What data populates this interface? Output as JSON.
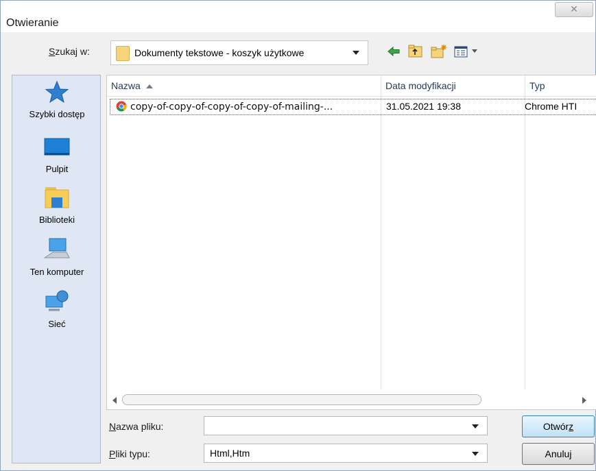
{
  "window": {
    "title": "Otwieranie",
    "close_glyph": "✕"
  },
  "look_in": {
    "label_prefix": "",
    "label_underline": "S",
    "label_rest": "zukaj w:",
    "value": "Dokumenty tekstowe - koszyk użytkowe"
  },
  "toolbar": {
    "icons": [
      "back-icon",
      "up-folder-icon",
      "new-folder-icon",
      "view-menu-icon"
    ]
  },
  "places": [
    {
      "label": "Szybki dostęp",
      "icon": "star-icon"
    },
    {
      "label": "Pulpit",
      "icon": "desktop-icon"
    },
    {
      "label": "Biblioteki",
      "icon": "libraries-icon"
    },
    {
      "label": "Ten komputer",
      "icon": "computer-icon"
    },
    {
      "label": "Sieć",
      "icon": "network-icon"
    }
  ],
  "file_list": {
    "columns": [
      "Nazwa",
      "Data modyfikacji",
      "Typ"
    ],
    "sort_column": "Nazwa",
    "rows": [
      {
        "name": "copy-of-copy-of-copy-of-copy-of-mailing-...",
        "modified": "31.05.2021 19:38",
        "type": "Chrome HTI",
        "icon": "chrome-icon"
      }
    ]
  },
  "filename": {
    "label_underline": "N",
    "label_rest": "azwa pliku:",
    "value": ""
  },
  "filetype": {
    "label_underline": "P",
    "label_rest": "liki typu:",
    "value": "Html,Htm"
  },
  "buttons": {
    "open_prefix": "Otwór",
    "open_underline": "z",
    "cancel": "Anuluj"
  },
  "colors": {
    "places_bg": "#dee7f3",
    "default_button": "#bfe1f6",
    "header_text": "#1e395b"
  }
}
